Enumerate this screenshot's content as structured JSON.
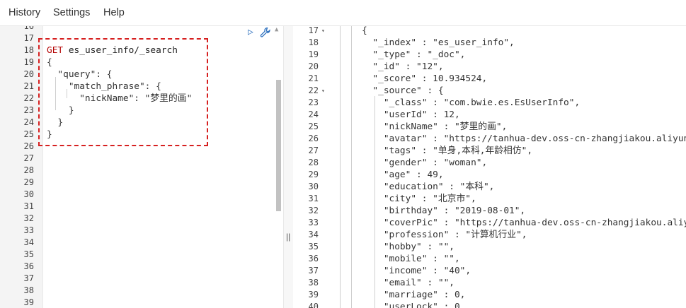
{
  "menu": {
    "history": "History",
    "settings": "Settings",
    "help": "Help"
  },
  "request_editor": {
    "line_numbers": [
      "16",
      "17",
      "18",
      "19",
      "20",
      "21",
      "22",
      "23",
      "24",
      "25",
      "26",
      "27",
      "28",
      "29",
      "30",
      "31",
      "32",
      "33",
      "34",
      "35",
      "36",
      "37",
      "38",
      "39"
    ],
    "method": "GET",
    "path": "es_user_info/_search",
    "lines": [
      "{",
      "  \"query\": {",
      "    \"match_phrase\": {",
      "      \"nickName\": \"梦里的画\"",
      "    }",
      "  }",
      "}"
    ],
    "icons": {
      "run": "play-icon",
      "settings": "wrench-icon"
    }
  },
  "response_viewer": {
    "line_numbers": [
      "17",
      "18",
      "19",
      "20",
      "21",
      "22",
      "23",
      "24",
      "25",
      "26",
      "27",
      "28",
      "29",
      "30",
      "31",
      "32",
      "33",
      "34",
      "35",
      "36",
      "37",
      "38",
      "39",
      "40"
    ],
    "lines": [
      "{",
      "  \"_index\" : \"es_user_info\",",
      "  \"_type\" : \"_doc\",",
      "  \"_id\" : \"12\",",
      "  \"_score\" : 10.934524,",
      "  \"_source\" : {",
      "    \"_class\" : \"com.bwie.es.EsUserInfo\",",
      "    \"userId\" : 12,",
      "    \"nickName\" : \"梦里的画\",",
      "    \"avatar\" : \"https://tanhua-dev.oss-cn-zhangjiakou.aliyun",
      "    \"tags\" : \"单身,本科,年龄相仿\",",
      "    \"gender\" : \"woman\",",
      "    \"age\" : 49,",
      "    \"education\" : \"本科\",",
      "    \"city\" : \"北京市\",",
      "    \"birthday\" : \"2019-08-01\",",
      "    \"coverPic\" : \"https://tanhua-dev.oss-cn-zhangjiakou.aliy",
      "    \"profession\" : \"计算机行业\",",
      "    \"hobby\" : \"\",",
      "    \"mobile\" : \"\",",
      "    \"income\" : \"40\",",
      "    \"email\" : \"\",",
      "    \"marriage\" : 0,",
      "    \"userLock\" : 0"
    ]
  }
}
